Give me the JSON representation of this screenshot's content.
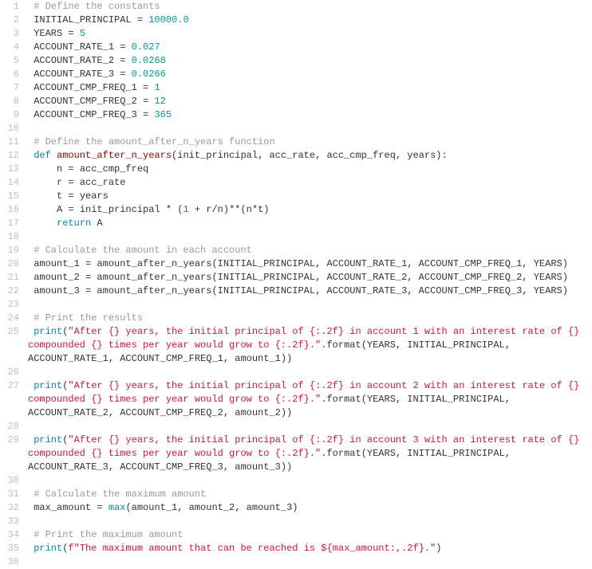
{
  "lines": [
    {
      "n": 1,
      "tokens": [
        {
          "t": " ",
          "c": ""
        },
        {
          "t": "# Define the constants",
          "c": "c-comment"
        }
      ]
    },
    {
      "n": 2,
      "tokens": [
        {
          "t": " INITIAL_PRINCIPAL ",
          "c": "c-id"
        },
        {
          "t": "=",
          "c": "c-op"
        },
        {
          "t": " ",
          "c": ""
        },
        {
          "t": "10000.0",
          "c": "c-num"
        }
      ]
    },
    {
      "n": 3,
      "tokens": [
        {
          "t": " YEARS ",
          "c": "c-id"
        },
        {
          "t": "=",
          "c": "c-op"
        },
        {
          "t": " ",
          "c": ""
        },
        {
          "t": "5",
          "c": "c-num"
        }
      ]
    },
    {
      "n": 4,
      "tokens": [
        {
          "t": " ACCOUNT_RATE_1 ",
          "c": "c-id"
        },
        {
          "t": "=",
          "c": "c-op"
        },
        {
          "t": " ",
          "c": ""
        },
        {
          "t": "0.027",
          "c": "c-num"
        }
      ]
    },
    {
      "n": 5,
      "tokens": [
        {
          "t": " ACCOUNT_RATE_2 ",
          "c": "c-id"
        },
        {
          "t": "=",
          "c": "c-op"
        },
        {
          "t": " ",
          "c": ""
        },
        {
          "t": "0.0268",
          "c": "c-num"
        }
      ]
    },
    {
      "n": 6,
      "tokens": [
        {
          "t": " ACCOUNT_RATE_3 ",
          "c": "c-id"
        },
        {
          "t": "=",
          "c": "c-op"
        },
        {
          "t": " ",
          "c": ""
        },
        {
          "t": "0.0266",
          "c": "c-num"
        }
      ]
    },
    {
      "n": 7,
      "tokens": [
        {
          "t": " ACCOUNT_CMP_FREQ_1 ",
          "c": "c-id"
        },
        {
          "t": "=",
          "c": "c-op"
        },
        {
          "t": " ",
          "c": ""
        },
        {
          "t": "1",
          "c": "c-num"
        }
      ]
    },
    {
      "n": 8,
      "tokens": [
        {
          "t": " ACCOUNT_CMP_FREQ_2 ",
          "c": "c-id"
        },
        {
          "t": "=",
          "c": "c-op"
        },
        {
          "t": " ",
          "c": ""
        },
        {
          "t": "12",
          "c": "c-num"
        }
      ]
    },
    {
      "n": 9,
      "tokens": [
        {
          "t": " ACCOUNT_CMP_FREQ_3 ",
          "c": "c-id"
        },
        {
          "t": "=",
          "c": "c-op"
        },
        {
          "t": " ",
          "c": ""
        },
        {
          "t": "365",
          "c": "c-num"
        }
      ]
    },
    {
      "n": 10,
      "tokens": [
        {
          "t": " ",
          "c": ""
        }
      ]
    },
    {
      "n": 11,
      "tokens": [
        {
          "t": " ",
          "c": ""
        },
        {
          "t": "# Define the amount_after_n_years function",
          "c": "c-comment"
        }
      ]
    },
    {
      "n": 12,
      "tokens": [
        {
          "t": " ",
          "c": ""
        },
        {
          "t": "def",
          "c": "c-kw"
        },
        {
          "t": " ",
          "c": ""
        },
        {
          "t": "amount_after_n_years",
          "c": "c-def"
        },
        {
          "t": "(init_principal, acc_rate, acc_cmp_freq, years):",
          "c": "c-id"
        }
      ]
    },
    {
      "n": 13,
      "tokens": [
        {
          "t": "     n ",
          "c": "c-id"
        },
        {
          "t": "=",
          "c": "c-op"
        },
        {
          "t": " acc_cmp_freq",
          "c": "c-id"
        }
      ]
    },
    {
      "n": 14,
      "tokens": [
        {
          "t": "     r ",
          "c": "c-id"
        },
        {
          "t": "=",
          "c": "c-op"
        },
        {
          "t": " acc_rate",
          "c": "c-id"
        }
      ]
    },
    {
      "n": 15,
      "tokens": [
        {
          "t": "     t ",
          "c": "c-id"
        },
        {
          "t": "=",
          "c": "c-op"
        },
        {
          "t": " years",
          "c": "c-id"
        }
      ]
    },
    {
      "n": 16,
      "tokens": [
        {
          "t": "     A ",
          "c": "c-id"
        },
        {
          "t": "=",
          "c": "c-op"
        },
        {
          "t": " init_principal ",
          "c": "c-id"
        },
        {
          "t": "*",
          "c": "c-op"
        },
        {
          "t": " (",
          "c": "c-id"
        },
        {
          "t": "1",
          "c": "c-num"
        },
        {
          "t": " ",
          "c": ""
        },
        {
          "t": "+",
          "c": "c-op"
        },
        {
          "t": " r",
          "c": "c-id"
        },
        {
          "t": "/",
          "c": "c-op"
        },
        {
          "t": "n)",
          "c": "c-id"
        },
        {
          "t": "**",
          "c": "c-op"
        },
        {
          "t": "(n",
          "c": "c-id"
        },
        {
          "t": "*",
          "c": "c-op"
        },
        {
          "t": "t)",
          "c": "c-id"
        }
      ]
    },
    {
      "n": 17,
      "tokens": [
        {
          "t": "     ",
          "c": ""
        },
        {
          "t": "return",
          "c": "c-kw"
        },
        {
          "t": " A",
          "c": "c-id"
        }
      ]
    },
    {
      "n": 18,
      "tokens": [
        {
          "t": " ",
          "c": ""
        }
      ]
    },
    {
      "n": 19,
      "tokens": [
        {
          "t": " ",
          "c": ""
        },
        {
          "t": "# Calculate the amount in each account",
          "c": "c-comment"
        }
      ]
    },
    {
      "n": 20,
      "tokens": [
        {
          "t": " amount_1 ",
          "c": "c-id"
        },
        {
          "t": "=",
          "c": "c-op"
        },
        {
          "t": " amount_after_n_years(INITIAL_PRINCIPAL, ACCOUNT_RATE_1, ACCOUNT_CMP_FREQ_1, YEARS)",
          "c": "c-id"
        }
      ]
    },
    {
      "n": 21,
      "tokens": [
        {
          "t": " amount_2 ",
          "c": "c-id"
        },
        {
          "t": "=",
          "c": "c-op"
        },
        {
          "t": " amount_after_n_years(INITIAL_PRINCIPAL, ACCOUNT_RATE_2, ACCOUNT_CMP_FREQ_2, YEARS)",
          "c": "c-id"
        }
      ]
    },
    {
      "n": 22,
      "tokens": [
        {
          "t": " amount_3 ",
          "c": "c-id"
        },
        {
          "t": "=",
          "c": "c-op"
        },
        {
          "t": " amount_after_n_years(INITIAL_PRINCIPAL, ACCOUNT_RATE_3, ACCOUNT_CMP_FREQ_3, YEARS)",
          "c": "c-id"
        }
      ]
    },
    {
      "n": 23,
      "tokens": [
        {
          "t": " ",
          "c": ""
        }
      ]
    },
    {
      "n": 24,
      "tokens": [
        {
          "t": " ",
          "c": ""
        },
        {
          "t": "# Print the results",
          "c": "c-comment"
        }
      ]
    },
    {
      "n": 25,
      "wrap": true,
      "tokens": [
        {
          "t": " ",
          "c": ""
        },
        {
          "t": "print",
          "c": "c-kw"
        },
        {
          "t": "(",
          "c": "c-id"
        },
        {
          "t": "\"After {} years, the initial principal of {:.2f} in account 1 with an interest rate of {} compounded {} times per year would grow to {:.2f}.\"",
          "c": "c-str"
        },
        {
          "t": ".",
          "c": "c-op"
        },
        {
          "t": "format",
          "c": "c-id"
        },
        {
          "t": "(YEARS, INITIAL_PRINCIPAL, ACCOUNT_RATE_1, ACCOUNT_CMP_FREQ_1, amount_1))",
          "c": "c-id"
        }
      ]
    },
    {
      "n": 26,
      "tokens": [
        {
          "t": " ",
          "c": ""
        }
      ]
    },
    {
      "n": 27,
      "wrap": true,
      "tokens": [
        {
          "t": " ",
          "c": ""
        },
        {
          "t": "print",
          "c": "c-kw"
        },
        {
          "t": "(",
          "c": "c-id"
        },
        {
          "t": "\"After {} years, the initial principal of {:.2f} in account 2 with an interest rate of {} compounded {} times per year would grow to {:.2f}.\"",
          "c": "c-str"
        },
        {
          "t": ".",
          "c": "c-op"
        },
        {
          "t": "format",
          "c": "c-id"
        },
        {
          "t": "(YEARS, INITIAL_PRINCIPAL, ACCOUNT_RATE_2, ACCOUNT_CMP_FREQ_2, amount_2))",
          "c": "c-id"
        }
      ]
    },
    {
      "n": 28,
      "tokens": [
        {
          "t": " ",
          "c": ""
        }
      ]
    },
    {
      "n": 29,
      "wrap": true,
      "tokens": [
        {
          "t": " ",
          "c": ""
        },
        {
          "t": "print",
          "c": "c-kw"
        },
        {
          "t": "(",
          "c": "c-id"
        },
        {
          "t": "\"After {} years, the initial principal of {:.2f} in account 3 with an interest rate of {} compounded {} times per year would grow to {:.2f}.\"",
          "c": "c-str"
        },
        {
          "t": ".",
          "c": "c-op"
        },
        {
          "t": "format",
          "c": "c-id"
        },
        {
          "t": "(YEARS, INITIAL_PRINCIPAL, ACCOUNT_RATE_3, ACCOUNT_CMP_FREQ_3, amount_3))",
          "c": "c-id"
        }
      ]
    },
    {
      "n": 30,
      "tokens": [
        {
          "t": " ",
          "c": ""
        }
      ]
    },
    {
      "n": 31,
      "tokens": [
        {
          "t": " ",
          "c": ""
        },
        {
          "t": "# Calculate the maximum amount",
          "c": "c-comment"
        }
      ]
    },
    {
      "n": 32,
      "tokens": [
        {
          "t": " max_amount ",
          "c": "c-id"
        },
        {
          "t": "=",
          "c": "c-op"
        },
        {
          "t": " ",
          "c": ""
        },
        {
          "t": "max",
          "c": "c-kw"
        },
        {
          "t": "(amount_1, amount_2, amount_3)",
          "c": "c-id"
        }
      ]
    },
    {
      "n": 33,
      "tokens": [
        {
          "t": " ",
          "c": ""
        }
      ]
    },
    {
      "n": 34,
      "tokens": [
        {
          "t": " ",
          "c": ""
        },
        {
          "t": "# Print the maximum amount",
          "c": "c-comment"
        }
      ]
    },
    {
      "n": 35,
      "tokens": [
        {
          "t": " ",
          "c": ""
        },
        {
          "t": "print",
          "c": "c-kw"
        },
        {
          "t": "(",
          "c": "c-id"
        },
        {
          "t": "f\"The maximum amount that can be reached is ${max_amount:,.2f}.\"",
          "c": "c-str"
        },
        {
          "t": ")",
          "c": "c-id"
        }
      ]
    },
    {
      "n": 36,
      "tokens": [
        {
          "t": " ",
          "c": ""
        }
      ]
    }
  ]
}
